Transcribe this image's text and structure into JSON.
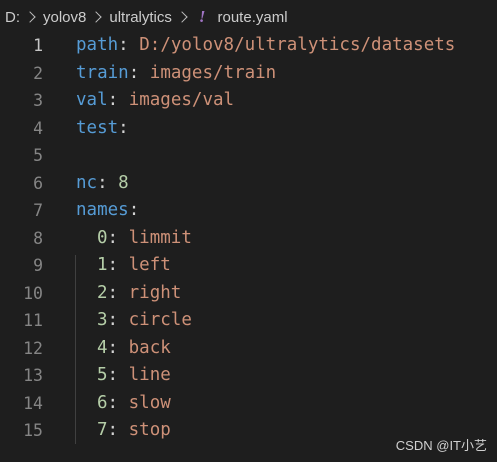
{
  "breadcrumb": {
    "items": [
      "D:",
      "yolov8",
      "ultralytics"
    ],
    "file_icon": "!",
    "file_name": "route.yaml"
  },
  "editor": {
    "line_numbers": [
      "1",
      "2",
      "3",
      "4",
      "5",
      "6",
      "7",
      "8",
      "9",
      "10",
      "11",
      "12",
      "13",
      "14",
      "15"
    ],
    "path_key": "path",
    "path_value": "D:/yolov8/ultralytics/datasets",
    "train_key": "train",
    "train_value": "images/train",
    "val_key": "val",
    "val_value": "images/val",
    "test_key": "test",
    "nc_key": "nc",
    "nc_value": "8",
    "names_key": "names",
    "names": [
      {
        "idx": "0",
        "label": "limmit"
      },
      {
        "idx": "1",
        "label": "left"
      },
      {
        "idx": "2",
        "label": "right"
      },
      {
        "idx": "3",
        "label": "circle"
      },
      {
        "idx": "4",
        "label": "back"
      },
      {
        "idx": "5",
        "label": "line"
      },
      {
        "idx": "6",
        "label": "slow"
      },
      {
        "idx": "7",
        "label": "stop"
      }
    ],
    "colon": ":"
  },
  "watermark": "CSDN @IT小艺",
  "colors": {
    "background": "#1e1e1e",
    "key": "#569cd6",
    "string": "#ce9178",
    "number": "#b5cea8",
    "line_number": "#858585"
  }
}
